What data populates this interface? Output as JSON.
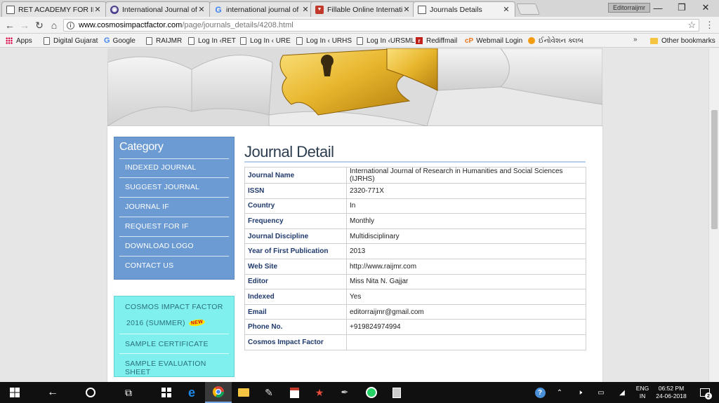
{
  "browser": {
    "tabs": [
      {
        "title": "RET ACADEMY FOR INTE",
        "favicon": "document-icon",
        "active": false
      },
      {
        "title": "International Journal of R",
        "favicon": "globe-icon",
        "active": false
      },
      {
        "title": "international journal of re",
        "favicon": "google-icon",
        "active": false
      },
      {
        "title": "Fillable Online Internatic",
        "favicon": "pdf-icon",
        "active": false
      },
      {
        "title": "Journals Details",
        "favicon": "document-icon",
        "active": true
      }
    ],
    "profile_name": "Editorraijmr",
    "url_host": "www.cosmosimpactfactor.com",
    "url_path": "/page/journals_details/4208.html",
    "bookmarks": [
      {
        "label": "Apps",
        "icon": "apps-icon"
      },
      {
        "label": "Digital Gujarat",
        "icon": "page-icon"
      },
      {
        "label": "Google",
        "icon": "google-icon"
      },
      {
        "label": "RAIJMR",
        "icon": "page-icon"
      },
      {
        "label": "Log In ‹RET",
        "icon": "page-icon"
      },
      {
        "label": "Log In ‹ URE",
        "icon": "page-icon"
      },
      {
        "label": "Log In ‹ URHS",
        "icon": "page-icon"
      },
      {
        "label": "Log In ‹URSML",
        "icon": "page-icon"
      },
      {
        "label": "Rediffmail",
        "icon": "rediff-icon"
      },
      {
        "label": "Webmail Login",
        "icon": "cp-icon"
      },
      {
        "label": "ઈનોવેશન ક્લબ",
        "icon": "orange-icon"
      }
    ],
    "other_bookmarks": "Other bookmarks"
  },
  "sidebar": {
    "title": "Category",
    "items": [
      "INDEXED JOURNAL",
      "SUGGEST JOURNAL",
      "JOURNAL IF",
      "REQUEST FOR IF",
      "DOWNLOAD LOGO",
      "CONTACT US"
    ],
    "cosmos": {
      "line1": "COSMOS IMPACT FACTOR",
      "line2": "2016 (SUMMER)",
      "badge": "NEW",
      "items": [
        "SAMPLE CERTIFICATE",
        "SAMPLE EVALUATION SHEET"
      ]
    }
  },
  "journal": {
    "heading": "Journal Detail",
    "rows": [
      {
        "key": "Journal Name",
        "value": "International Journal of Research in Humanities and Social Sciences (IJRHS)"
      },
      {
        "key": "ISSN",
        "value": "2320-771X"
      },
      {
        "key": "Country",
        "value": "In"
      },
      {
        "key": "Frequency",
        "value": "Monthly"
      },
      {
        "key": "Journal Discipline",
        "value": "Multidisciplinary"
      },
      {
        "key": "Year of First Publication",
        "value": "2013"
      },
      {
        "key": "Web Site",
        "value": "http://www.raijmr.com"
      },
      {
        "key": "Editor",
        "value": "Miss Nita N. Gajjar"
      },
      {
        "key": "Indexed",
        "value": "Yes"
      },
      {
        "key": "Email",
        "value": "editorraijmr@gmail.com"
      },
      {
        "key": "Phone No.",
        "value": "+919824974994"
      },
      {
        "key": "Cosmos Impact Factor",
        "value": ""
      }
    ]
  },
  "taskbar": {
    "language_line1": "ENG",
    "language_line2": "IN",
    "time": "06:52 PM",
    "date": "24-06-2018",
    "notification_count": "2"
  }
}
